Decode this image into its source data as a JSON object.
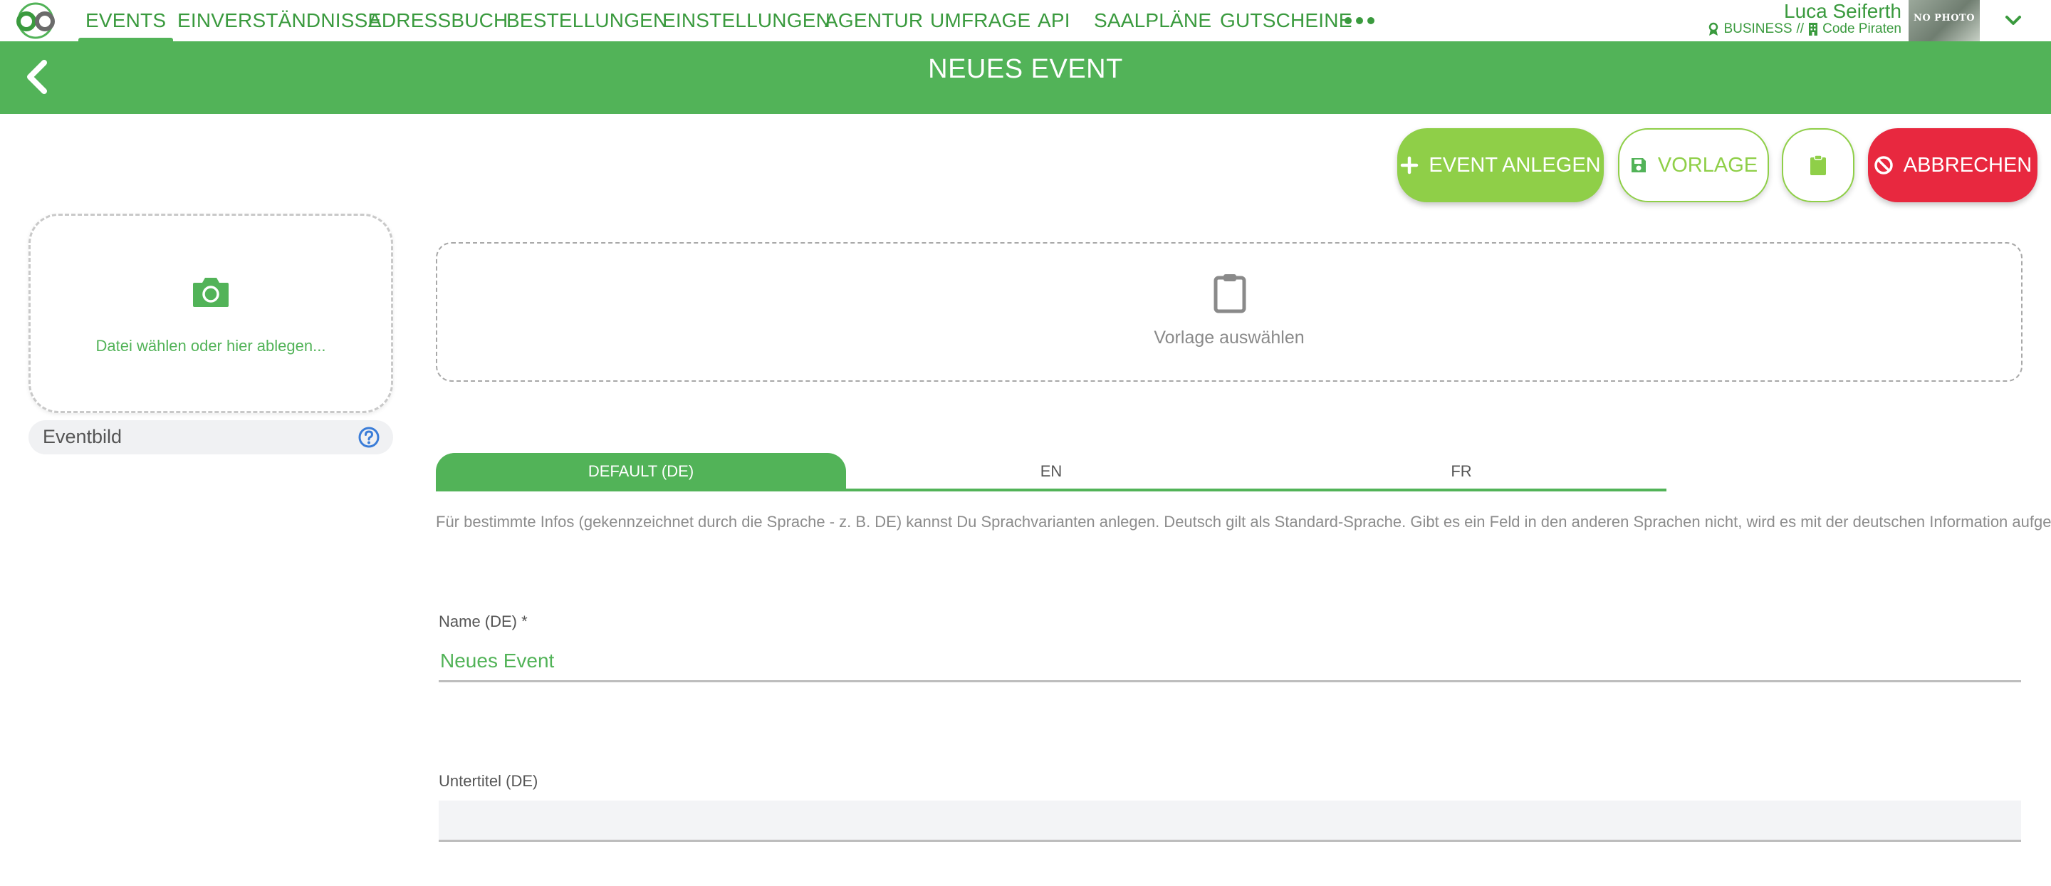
{
  "nav": {
    "items": [
      {
        "label": "EVENTS",
        "active": true
      },
      {
        "label": "EINVERSTÄNDNISSE"
      },
      {
        "label": "ADRESSBUCH"
      },
      {
        "label": "BESTELLUNGEN"
      },
      {
        "label": "EINSTELLUNGEN"
      },
      {
        "label": "AGENTUR"
      },
      {
        "label": "UMFRAGE"
      },
      {
        "label": "API"
      },
      {
        "label": "SAALPLÄNE"
      },
      {
        "label": "GUTSCHEINE"
      }
    ],
    "more_icon": "more-dots-icon"
  },
  "user": {
    "name": "Luca Seiferth",
    "plan": "BUSINESS",
    "separator": "//",
    "company": "Code Piraten",
    "avatar_text": "NO PHOTO"
  },
  "header": {
    "title": "NEUES EVENT"
  },
  "actions": {
    "create_label": "EVENT ANLEGEN",
    "template_label": "VORLAGE",
    "cancel_label": "ABBRECHEN"
  },
  "image_upload": {
    "drop_text": "Datei wählen oder hier ablegen...",
    "label": "Eventbild"
  },
  "template_select": {
    "text": "Vorlage auswählen"
  },
  "language_tabs": [
    {
      "label": "DEFAULT (DE)",
      "active": true
    },
    {
      "label": "EN"
    },
    {
      "label": "FR"
    }
  ],
  "info_text": "Für bestimmte Infos (gekennzeichnet durch die Sprache - z. B. DE) kannst Du Sprachvarianten anlegen. Deutsch gilt als Standard-Sprache. Gibt es ein Feld in den anderen Sprachen nicht, wird es mit der deutschen Information aufgefüllt.",
  "form": {
    "name_label": "Name (DE) *",
    "name_value": "Neues Event",
    "subtitle_label": "Untertitel (DE)",
    "subtitle_value": ""
  },
  "colors": {
    "brand_green": "#52b358",
    "nav_green": "#3a9a3e",
    "action_green": "#8fcf48",
    "danger_red": "#e8283f"
  }
}
